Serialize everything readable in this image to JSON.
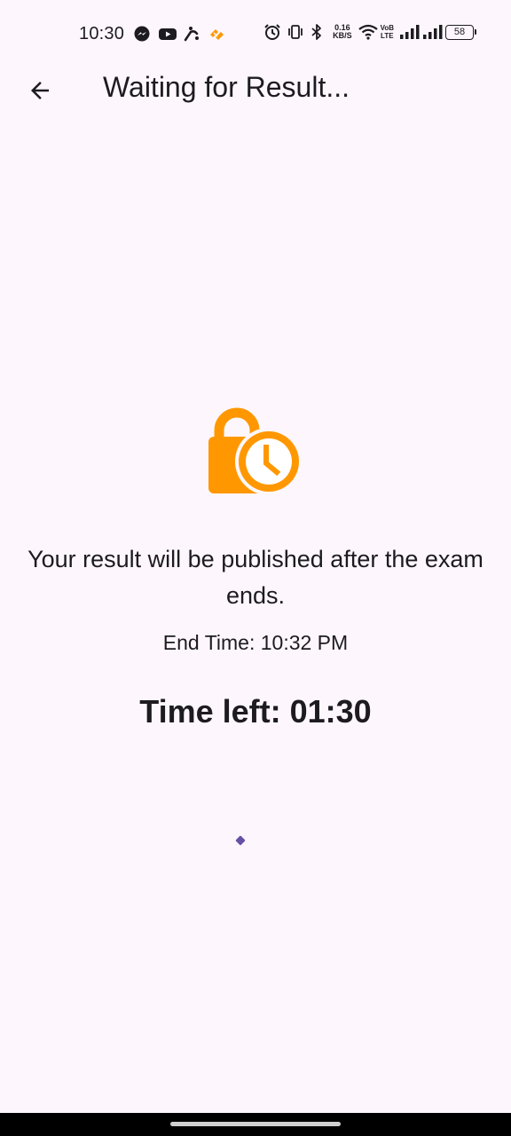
{
  "status_bar": {
    "time": "10:30",
    "net_speed_value": "0.16",
    "net_speed_unit": "KB/S",
    "volte_top": "VoB",
    "volte_bottom": "LTE",
    "battery_level": "58",
    "left_icons": [
      "messenger-icon",
      "youtube-icon",
      "telenor-icon",
      "app-notification-icon"
    ],
    "right_icons": [
      "alarm-icon",
      "vibrate-icon",
      "bluetooth-icon",
      "wifi-icon",
      "signal-icon",
      "signal-icon"
    ]
  },
  "app_bar": {
    "title": "Waiting for Result...",
    "back_icon": "arrow-back-icon"
  },
  "main": {
    "icon": "lock-clock-icon",
    "icon_color": "#ff9800",
    "message": "Your result will be published after the exam ends.",
    "end_time": "End Time: 10:32 PM",
    "time_left": "Time left: 01:30",
    "spinner_color": "#6750a4"
  }
}
